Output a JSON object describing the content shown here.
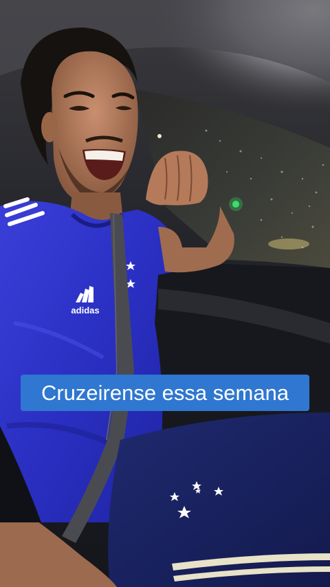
{
  "caption": {
    "text": "Cruzeirense essa semana",
    "background": "#2f77d0",
    "color": "#ffffff"
  },
  "jersey": {
    "brand": "adidas",
    "color": "#2a2fc2"
  }
}
